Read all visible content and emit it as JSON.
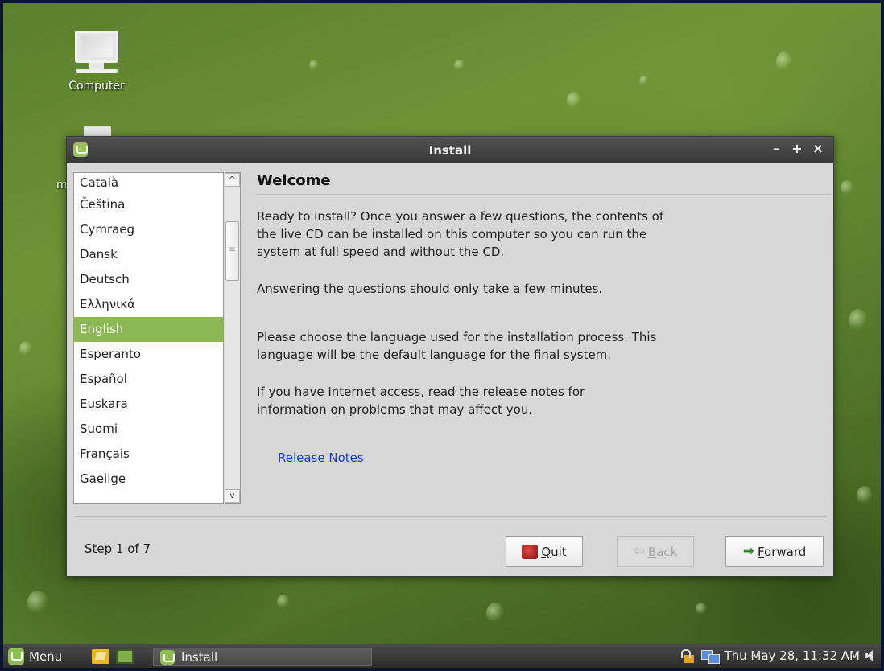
{
  "desktop": {
    "icons": [
      {
        "label": "Computer"
      },
      {
        "label": "m"
      }
    ]
  },
  "window": {
    "title": "Install",
    "controls": {
      "minimize": "–",
      "maximize": "+",
      "close": "×"
    },
    "languages": [
      "Català",
      "Čeština",
      "Cymraeg",
      "Dansk",
      "Deutsch",
      "Ελληνικά",
      "English",
      "Esperanto",
      "Español",
      "Euskara",
      "Suomi",
      "Français",
      "Gaeilge"
    ],
    "selected_language": "English",
    "scrollbar": {
      "up_arrow": "^",
      "down_arrow": "v",
      "thumb_grip": "≡"
    },
    "heading": "Welcome",
    "paragraphs": [
      "Ready to install? Once you answer a few questions, the contents of the live CD can be installed on this computer so you can run the system at full speed and without the CD.",
      "Answering the questions should only take a few minutes.",
      "Please choose the language used for the installation process. This language will be the default language for the final system.",
      "If you have Internet access, read the release notes for information on problems that may affect you."
    ],
    "release_notes_link": "Release Notes",
    "step_text": "Step 1 of 7",
    "buttons": {
      "quit_first": "Q",
      "quit_rest": "uit",
      "back_first": "B",
      "back_rest": "ack",
      "back_arrow": "⇦",
      "forward_first": "F",
      "forward_rest": "orward",
      "forward_arrow": "➡"
    }
  },
  "taskbar": {
    "menu_label": "Menu",
    "task_label": "Install",
    "clock": "Thu May 28, 11:32 AM"
  },
  "colors": {
    "selection": "#8cb755",
    "link": "#1b3cc4",
    "titlebar": "#3f3f3f"
  }
}
